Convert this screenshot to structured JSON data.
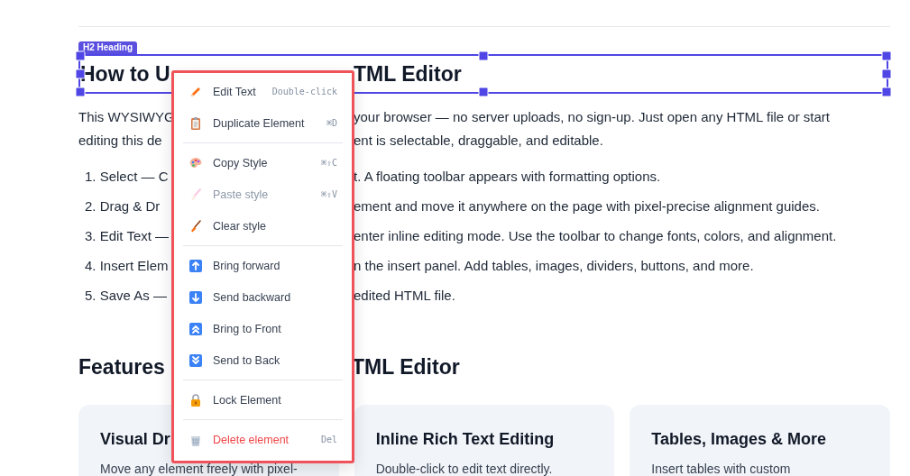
{
  "badge": "H2 Heading",
  "heading": {
    "left": "How to U",
    "right": "TML Editor"
  },
  "intro": [
    {
      "left": "This WYSIWYG",
      "right": "your browser — no server uploads, no sign-up. Just open any HTML file or start"
    },
    {
      "left": "editing this de",
      "right": "ent is selectable, draggable, and editable."
    }
  ],
  "steps": [
    {
      "left": "1. Select — C",
      "right": "t. A floating toolbar appears with formatting options."
    },
    {
      "left": "2. Drag & Dr",
      "right": "ement and move it anywhere on the page with pixel-precise alignment guides."
    },
    {
      "left": "3. Edit Text —",
      "right": "enter inline editing mode. Use the toolbar to change fonts, colors, and alignment."
    },
    {
      "left": "4. Insert Elem",
      "right": "n the insert panel. Add tables, images, dividers, buttons, and more."
    },
    {
      "left": "5. Save As —",
      "right": "edited HTML file."
    }
  ],
  "section_heading": {
    "left": "Features",
    "right": "TML Editor"
  },
  "cards": [
    {
      "title": "Visual Dr",
      "body": "Move any element freely with pixel-"
    },
    {
      "title": "Inline Rich Text Editing",
      "body": "Double-click to edit text directly."
    },
    {
      "title": "Tables, Images & More",
      "body": "Insert tables with custom"
    }
  ],
  "context_menu": {
    "groups": [
      [
        {
          "label": "Edit Text",
          "shortcut": "Double-click",
          "disabled": false,
          "kind": "action"
        },
        {
          "label": "Duplicate Element",
          "shortcut": "⌘D",
          "disabled": false,
          "kind": "action"
        }
      ],
      [
        {
          "label": "Copy Style",
          "shortcut": "⌘⇧C",
          "disabled": false,
          "kind": "action"
        },
        {
          "label": "Paste style",
          "shortcut": "⌘⇧V",
          "disabled": true,
          "kind": "action"
        },
        {
          "label": "Clear style",
          "disabled": false,
          "kind": "action"
        }
      ],
      [
        {
          "label": "Bring forward",
          "disabled": false,
          "kind": "action"
        },
        {
          "label": "Send backward",
          "disabled": false,
          "kind": "action"
        },
        {
          "label": "Bring to Front",
          "disabled": false,
          "kind": "action"
        },
        {
          "label": "Send to Back",
          "disabled": false,
          "kind": "action"
        }
      ],
      [
        {
          "label": "Lock Element",
          "disabled": false,
          "kind": "action"
        }
      ],
      [
        {
          "label": "Delete element",
          "shortcut": "Del",
          "disabled": false,
          "kind": "danger"
        }
      ]
    ]
  }
}
